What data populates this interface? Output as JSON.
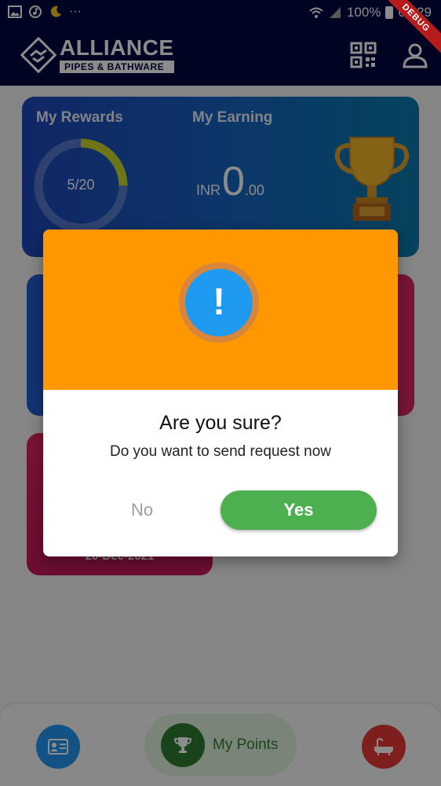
{
  "status_bar": {
    "battery": "100%",
    "time": "08:29",
    "more": "···"
  },
  "debug_banner": "DEBUG",
  "app_bar": {
    "logo_title": "ALLIANCE",
    "logo_subtitle": "PIPES & BATHWARE",
    "qr_icon": "qr-code-icon",
    "profile_icon": "person-icon"
  },
  "rewards_card": {
    "rewards_label": "My Rewards",
    "earning_label": "My Earning",
    "rewards_progress": "5/20",
    "rewards_fraction": 0.25,
    "currency": "INR",
    "earning_whole": "0",
    "earning_decimal": ".00"
  },
  "card3": {
    "date": "20-Dec-2021"
  },
  "dialog": {
    "title": "Are you sure?",
    "message": "Do you want to send request now",
    "icon_text": "!",
    "no_label": "No",
    "yes_label": "Yes",
    "header_color": "#ff9800",
    "yes_color": "#4caf50"
  },
  "bottom_nav": {
    "points_label": "My Points",
    "left_icon": "id-card-icon",
    "center_icon": "trophy-icon",
    "right_icon": "bathtub-icon"
  }
}
